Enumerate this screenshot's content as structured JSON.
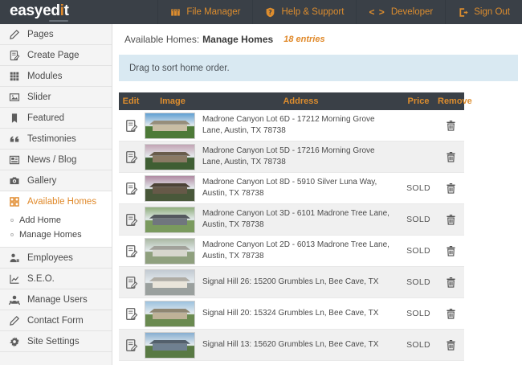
{
  "colors": {
    "topbar_bg": "#3a4047",
    "accent_orange": "#e0892a",
    "sidebar_bg": "#f4f4f4",
    "notice_bg": "#d9e9f2",
    "row_alt_bg": "#f0f0f0"
  },
  "topbar": {
    "logo_pre": "easyed",
    "logo_accent": "i",
    "logo_post": "t",
    "nav": [
      {
        "label": "File Manager",
        "icon": "archive-icon"
      },
      {
        "label": "Help & Support",
        "icon": "shield-question-icon"
      },
      {
        "label": "Developer",
        "icon": "code-icon",
        "icon_glyph": "< >"
      },
      {
        "label": "Sign Out",
        "icon": "sign-out-icon"
      }
    ]
  },
  "sidebar": {
    "items": [
      {
        "label": "Pages",
        "icon": "pencil-icon"
      },
      {
        "label": "Create Page",
        "icon": "page-edit-icon"
      },
      {
        "label": "Modules",
        "icon": "grid-icon"
      },
      {
        "label": "Slider",
        "icon": "image-icon"
      },
      {
        "label": "Featured",
        "icon": "bookmark-icon"
      },
      {
        "label": "Testimonies",
        "icon": "quote-icon"
      },
      {
        "label": "News / Blog",
        "icon": "newspaper-icon"
      },
      {
        "label": "Gallery",
        "icon": "camera-icon"
      },
      {
        "label": "Available Homes",
        "icon": "homes-grid-icon",
        "active": true
      },
      {
        "label": "Employees",
        "icon": "person-icon"
      },
      {
        "label": "S.E.O.",
        "icon": "line-chart-icon"
      },
      {
        "label": "Manage Users",
        "icon": "users-icon"
      },
      {
        "label": "Contact Form",
        "icon": "pencil-icon"
      },
      {
        "label": "Site Settings",
        "icon": "gear-icon"
      }
    ],
    "sub_items": [
      {
        "label": "Add Home"
      },
      {
        "label": "Manage Homes"
      }
    ]
  },
  "main": {
    "breadcrumb_section": "Available Homes:",
    "breadcrumb_page": "Manage Homes",
    "entries": "18 entries",
    "notice": "Drag to sort home order."
  },
  "table": {
    "columns": [
      "Edit",
      "Image",
      "Address",
      "Price",
      "Remove"
    ],
    "rows": [
      {
        "address": "Madrone Canyon Lot 6D - 17212 Morning Grove Lane, Austin, TX 78738",
        "price": "",
        "thumb": {
          "sky": "#5f9ed2",
          "house": "#c8bda4",
          "ground": "#4d7a38"
        }
      },
      {
        "address": "Madrone Canyon Lot 5D - 17216 Morning Grove Lane, Austin, TX 78738",
        "price": "",
        "thumb": {
          "sky": "#c3a4b4",
          "house": "#8a7a64",
          "ground": "#3f5e33"
        }
      },
      {
        "address": "Madrone Canyon Lot 8D - 5910 Silver Luna Way, Austin, TX 78738",
        "price": "SOLD",
        "thumb": {
          "sky": "#b08aa2",
          "house": "#665948",
          "ground": "#49583a"
        }
      },
      {
        "address": "Madrone Canyon Lot 3D - 6101 Madrone Tree Lane, Austin, TX 78738",
        "price": "SOLD",
        "thumb": {
          "sky": "#8fae7c",
          "house": "#70767e",
          "ground": "#7a9a5e"
        }
      },
      {
        "address": "Madrone Canyon Lot 2D - 6013 Madrone Tree Lane, Austin, TX 78738",
        "price": "SOLD",
        "thumb": {
          "sky": "#a9b8a2",
          "house": "#d6d6cd",
          "ground": "#8fa07e"
        }
      },
      {
        "address": "Signal Hill 26: 15200 Grumbles Ln, Bee Cave, TX",
        "price": "SOLD",
        "thumb": {
          "sky": "#c2cad2",
          "house": "#e9e5da",
          "ground": "#9aa09e"
        }
      },
      {
        "address": "Signal Hill 20: 15324 Grumbles Ln, Bee Cave, TX",
        "price": "SOLD",
        "thumb": {
          "sky": "#9cc2de",
          "house": "#beb298",
          "ground": "#6a8a50"
        }
      },
      {
        "address": "Signal Hill 13: 15620 Grumbles Ln, Bee Cave, TX",
        "price": "SOLD",
        "thumb": {
          "sky": "#86aed0",
          "house": "#6f8090",
          "ground": "#597a44"
        }
      }
    ]
  }
}
